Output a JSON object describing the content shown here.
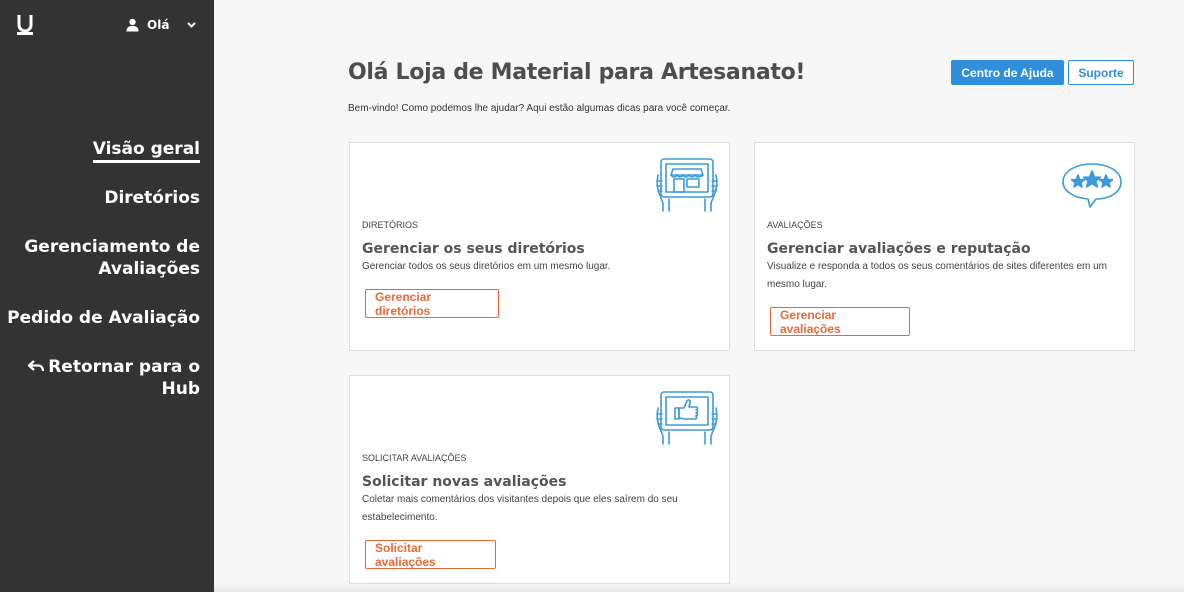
{
  "sidebar": {
    "user_label": "Olá",
    "nav": [
      {
        "label": "Visão geral"
      },
      {
        "label": "Diretórios"
      },
      {
        "label": "Gerenciamento de Avaliações"
      },
      {
        "label": "Pedido de Avaliação"
      },
      {
        "label": "Retornar para o Hub"
      }
    ]
  },
  "header": {
    "title": "Olá Loja de Material para Artesanato!",
    "help_button": "Centro de Ajuda",
    "support_button": "Suporte",
    "welcome": "Bem-vindo! Como podemos lhe ajudar? Aqui estão algumas dicas para você começar."
  },
  "cards": [
    {
      "category": "DIRETÓRIOS",
      "title": "Gerenciar os seus diretórios",
      "description": "Gerenciar todos os seus diretórios em um mesmo lugar.",
      "button": "Gerenciar diretórios",
      "icon": "tablet-store-icon"
    },
    {
      "category": "AVALIAÇÕES",
      "title": "Gerenciar avaliações e reputação",
      "description": "Visualize e responda a todos os seus comentários de sites diferentes em um mesmo lugar.",
      "button": "Gerenciar avaliações",
      "icon": "speech-bubble-stars-icon"
    },
    {
      "category": "SOLICITAR AVALIAÇÕES",
      "title": "Solicitar novas avaliações",
      "description": "Coletar mais comentários dos visitantes depois que eles saírem do seu estabelecimento.",
      "button": "Solicitar avaliações",
      "icon": "tablet-thumbs-up-icon"
    }
  ],
  "colors": {
    "sidebar_bg": "#333333",
    "primary_blue": "#2f8fdc",
    "accent_orange": "#e8693a",
    "illustration_blue": "#3a9bdc"
  }
}
